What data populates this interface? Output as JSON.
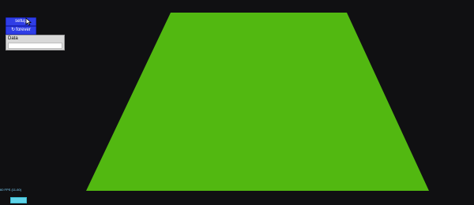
{
  "viewport": {
    "background": "#101012",
    "shape_color": "#52b811"
  },
  "toolbar": {
    "setup_label": "setup",
    "forever_label": "forever",
    "forever_icon": "↻"
  },
  "monitor": {
    "label": "Data",
    "value": ""
  },
  "stats": {
    "fps_text": "60 FPS (11-60)"
  },
  "icons": {
    "cursor": "pointer-cursor-icon",
    "forever": "refresh-icon"
  }
}
